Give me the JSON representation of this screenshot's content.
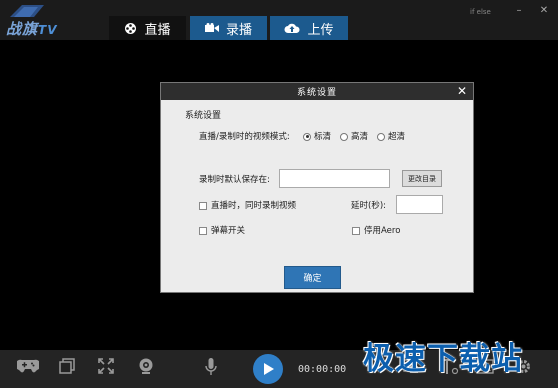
{
  "app": {
    "logo_text": "战旗",
    "logo_tv": "TV",
    "user_link": "if else"
  },
  "tabs": [
    {
      "label": "直播",
      "icon": "film-reel-icon"
    },
    {
      "label": "录播",
      "icon": "camera-icon"
    },
    {
      "label": "上传",
      "icon": "cloud-upload-icon"
    }
  ],
  "dialog": {
    "title": "系统设置",
    "section_title": "系统设置",
    "mode_label": "直播/录制时的视频模式:",
    "mode_options": [
      "标清",
      "高清",
      "超清"
    ],
    "mode_selected": "标清",
    "save_label": "录制时默认保存在:",
    "save_value": "",
    "browse_label": "更改目录",
    "record_while_live_label": "直播时，同时录制视频",
    "delay_label": "延时(秒):",
    "delay_value": "",
    "danmaku_label": "弹幕开关",
    "aero_label": "停用Aero",
    "ok_label": "确定"
  },
  "bottom": {
    "timer": "00:00:00"
  },
  "watermark": "极速下载站",
  "colors": {
    "accent": "#2f75b5",
    "tab_active_bg": "#111111",
    "tab_inactive_bg": "#1c5a8e",
    "watermark": "#0c5fae"
  }
}
